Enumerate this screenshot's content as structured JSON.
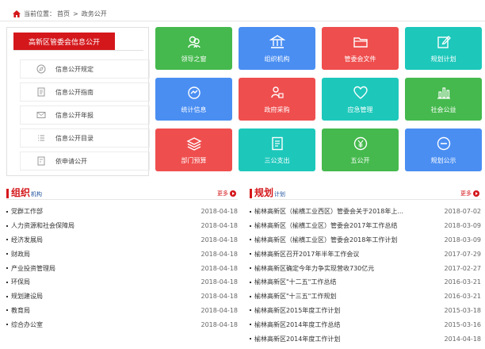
{
  "breadcrumb": {
    "label": "当前位置：",
    "home": "首页",
    "sep": ">",
    "current": "政务公开"
  },
  "info_panel": {
    "title": "高新区管委会信息公开",
    "items": [
      {
        "label": "信息公开规定",
        "icon": "compass-icon"
      },
      {
        "label": "信息公开指南",
        "icon": "document-icon"
      },
      {
        "label": "信息公开年报",
        "icon": "envelope-icon"
      },
      {
        "label": "信息公开目录",
        "icon": "list-icon"
      },
      {
        "label": "依申请公开",
        "icon": "form-icon"
      }
    ]
  },
  "tiles": [
    {
      "label": "领导之窗",
      "icon": "people-icon",
      "color": "#45b94d"
    },
    {
      "label": "组织机构",
      "icon": "building-icon",
      "color": "#4a8ef2"
    },
    {
      "label": "管委会文件",
      "icon": "folder-icon",
      "color": "#ef4e4e"
    },
    {
      "label": "规划计划",
      "icon": "edit-icon",
      "color": "#1dc8bb"
    },
    {
      "label": "统计信息",
      "icon": "pie-icon",
      "color": "#4a8ef2"
    },
    {
      "label": "政府采购",
      "icon": "purchase-icon",
      "color": "#ef4e4e"
    },
    {
      "label": "应急管理",
      "icon": "heart-icon",
      "color": "#1dc8bb"
    },
    {
      "label": "社会公益",
      "icon": "bar-chart-icon",
      "color": "#45b94d"
    },
    {
      "label": "部门预算",
      "icon": "layers-icon",
      "color": "#ef4e4e"
    },
    {
      "label": "三公支出",
      "icon": "doc-list-icon",
      "color": "#1dc8bb"
    },
    {
      "label": "五公开",
      "icon": "yen-icon",
      "color": "#45b94d"
    },
    {
      "label": "规划公示",
      "icon": "minus-circle-icon",
      "color": "#4a8ef2"
    }
  ],
  "org": {
    "title_main": "组织",
    "title_sub": "机构",
    "more": "更多",
    "rows": [
      {
        "title": "党群工作部",
        "date": "2018-04-18"
      },
      {
        "title": "人力资源和社会保障局",
        "date": "2018-04-18"
      },
      {
        "title": "经济发展局",
        "date": "2018-04-18"
      },
      {
        "title": "财政局",
        "date": "2018-04-18"
      },
      {
        "title": "产业投资管理局",
        "date": "2018-04-18"
      },
      {
        "title": "环保局",
        "date": "2018-04-18"
      },
      {
        "title": "规划建设局",
        "date": "2018-04-18"
      },
      {
        "title": "教育局",
        "date": "2018-04-18"
      },
      {
        "title": "综合办公室",
        "date": "2018-04-18"
      }
    ]
  },
  "plan": {
    "title_main": "规划",
    "title_sub": "计划",
    "more": "更多",
    "rows": [
      {
        "title": "榆林高新区（榆横工业西区）管委会关于2018年上...",
        "date": "2018-07-02"
      },
      {
        "title": "榆林高新区（榆横工业区）管委会2017年工作总结",
        "date": "2018-03-09"
      },
      {
        "title": "榆林高新区（榆横工业区）管委会2018年工作计划",
        "date": "2018-03-09"
      },
      {
        "title": "榆林高新区召开2017年半年工作会议",
        "date": "2017-07-29"
      },
      {
        "title": "榆林高新区确定今年力争实现营收730亿元",
        "date": "2017-02-27"
      },
      {
        "title": "榆林高新区\"十二五\"工作总结",
        "date": "2016-03-21"
      },
      {
        "title": "榆林高新区\"十三五\"工作规划",
        "date": "2016-03-21"
      },
      {
        "title": "榆林高新区2015年度工作计划",
        "date": "2015-03-18"
      },
      {
        "title": "榆林高新区2014年度工作总结",
        "date": "2015-03-16"
      },
      {
        "title": "榆林高新区2014年度工作计划",
        "date": "2014-04-18"
      }
    ]
  }
}
